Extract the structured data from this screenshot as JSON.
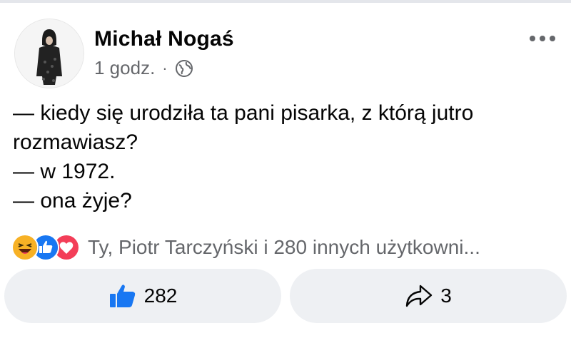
{
  "post": {
    "author": "Michał Nogaś",
    "timestamp": "1 godz.",
    "separator": "·",
    "visibility_icon": "globe-icon",
    "menu_icon": "more-horizontal-icon",
    "lines": [
      "— kiedy się urodziła ta pani pisarka, z którą jutro",
      "rozmawiasz?",
      "— w 1972.",
      "— ona żyje?"
    ]
  },
  "reactions": {
    "icons": [
      "haha-icon",
      "like-icon",
      "love-icon"
    ],
    "summary": "Ty, Piotr Tarczyński i 280 innych użytkowni..."
  },
  "actions": {
    "like": {
      "icon": "thumbs-up-icon",
      "count": "282"
    },
    "share": {
      "icon": "share-arrow-icon",
      "count": "3"
    }
  },
  "colors": {
    "like_blue": "#1877f2",
    "love_red": "#f33e58",
    "haha_yellow": "#f7b125",
    "muted_text": "#65676b",
    "button_bg": "#eef0f3"
  }
}
